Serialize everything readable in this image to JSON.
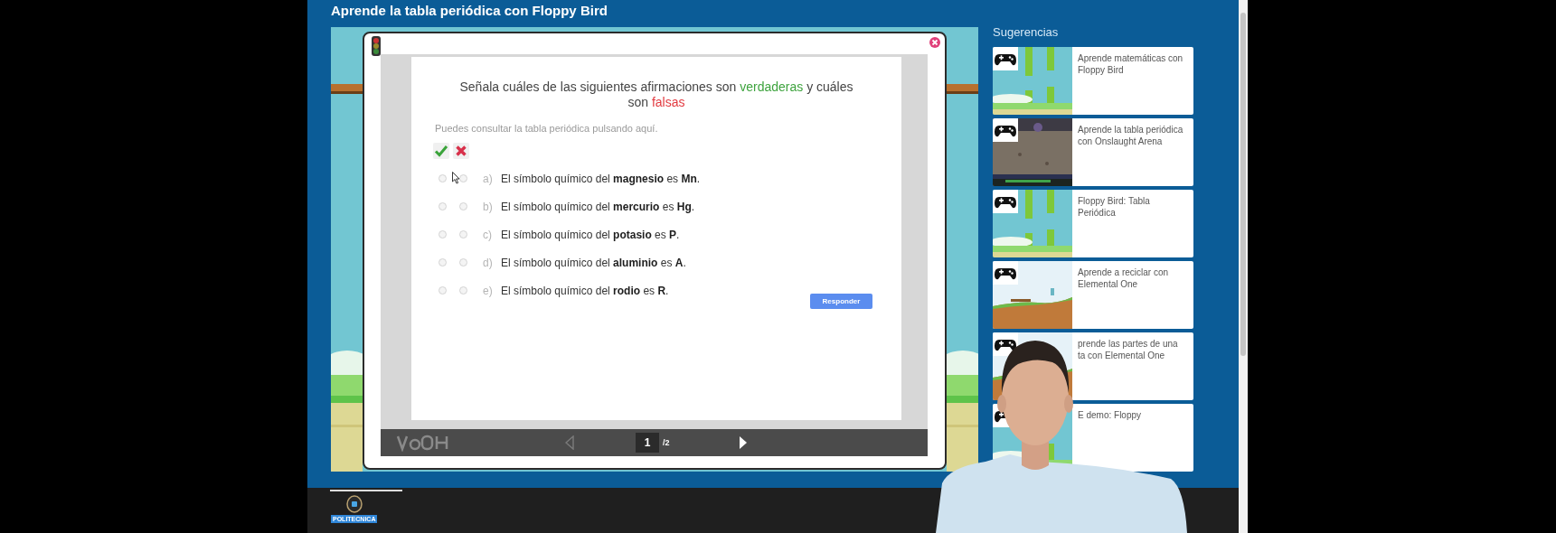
{
  "page_title": "Aprende la tabla periódica con Floppy Bird",
  "quiz": {
    "heading": [
      {
        "text": "Señala cuáles de las siguientes afirmaciones son ",
        "color": "#444444"
      },
      {
        "text": "verdaderas",
        "color": "#3ea33e"
      },
      {
        "text": " y cuáles son ",
        "color": "#444444"
      },
      {
        "text": "falsas",
        "color": "#e23a40"
      }
    ],
    "hint": "Puedes consultar la tabla periódica pulsando aquí.",
    "statements": [
      {
        "letter": "a)",
        "text": "El símbolo químico del **magnesio** es **Mn**.",
        "true_selected": false,
        "false_selected": false
      },
      {
        "letter": "b)",
        "text": "El símbolo químico del **mercurio** es **Hg**.",
        "true_selected": false,
        "false_selected": false
      },
      {
        "letter": "c)",
        "text": "El símbolo químico del **potasio** es **P**.",
        "true_selected": false,
        "false_selected": false
      },
      {
        "letter": "d)",
        "text": "El símbolo químico del **aluminio** es **A**.",
        "true_selected": false,
        "false_selected": false
      },
      {
        "letter": "e)",
        "text": "El símbolo químico del **rodio** es **R**.",
        "true_selected": false,
        "false_selected": false
      }
    ],
    "submit": "Responder",
    "prev_disabled": true,
    "page": "1",
    "page_total": "/2"
  },
  "sidebar": {
    "title": "Sugerencias",
    "items": [
      {
        "title": "Aprende matemáticas con\nFloppy Bird"
      },
      {
        "title": "Aprende la tabla periódica\ncon Onslaught Arena"
      },
      {
        "title": "Floppy Bird: Tabla\nPeriódica"
      },
      {
        "title": "Aprende a reciclar con\nElemental One"
      },
      {
        "title": "prende las partes de una\nta con Elemental One"
      },
      {
        "title": "E demo: Floppy"
      }
    ]
  },
  "footer": {
    "label": "POLITECNICA"
  }
}
